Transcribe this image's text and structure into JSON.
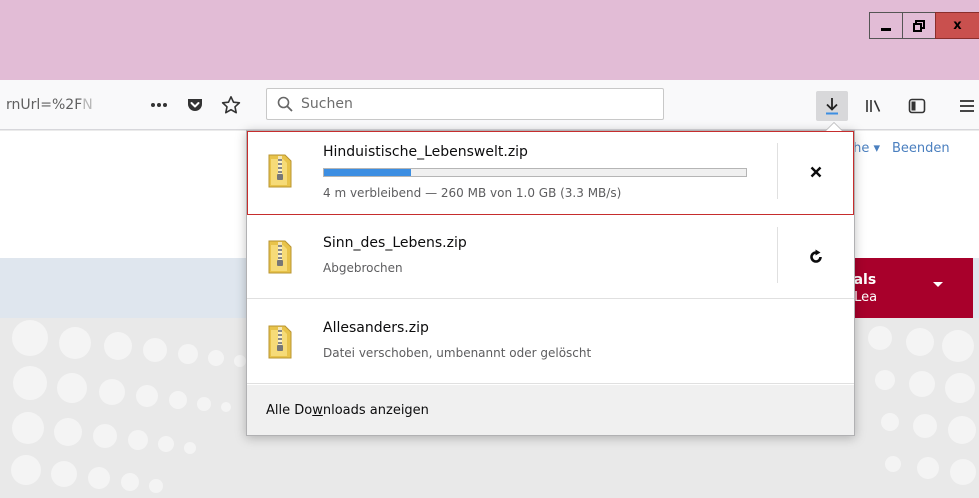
{
  "window": {
    "minimize_label": "▁",
    "restore_label": "⧉",
    "close_label": "x",
    "accent_color": "#e2bcd6",
    "close_color": "#c9504e"
  },
  "toolbar": {
    "url_fragment": "rnUrl=%2F",
    "url_fade": "N",
    "search_placeholder": "Suchen",
    "page_actions_icon": "ellipsis-icon",
    "pocket_icon": "pocket-icon",
    "bookmark_icon": "star-icon",
    "download_icon": "download-arrow-icon",
    "library_icon": "library-icon",
    "sidebar_icon": "sidebar-icon",
    "menu_icon": "hamburger-icon"
  },
  "page": {
    "lang_link": "ache ▾",
    "end_link": "Beenden",
    "login_line1": "t als",
    "login_line2": "a Lea",
    "brand_color": "#a8002b"
  },
  "downloads": {
    "items": [
      {
        "name": "Hinduistische_Lebenswelt.zip",
        "status": "4 m verbleibend — 260 MB von 1.0 GB (3.3 MB/s)",
        "progress": 0.205,
        "action": "cancel",
        "action_glyph": "✕"
      },
      {
        "name": "Sinn_des_Lebens.zip",
        "status": "Abgebrochen",
        "action": "retry",
        "action_glyph": "↻"
      },
      {
        "name": "Allesanders.zip",
        "status": "Datei verschoben, umbenannt oder gelöscht"
      }
    ],
    "footer_pre": "Alle Do",
    "footer_accel": "w",
    "footer_post": "nloads anzeigen",
    "progress_color": "#3c8ee2",
    "selection_color": "#c62d2d"
  }
}
